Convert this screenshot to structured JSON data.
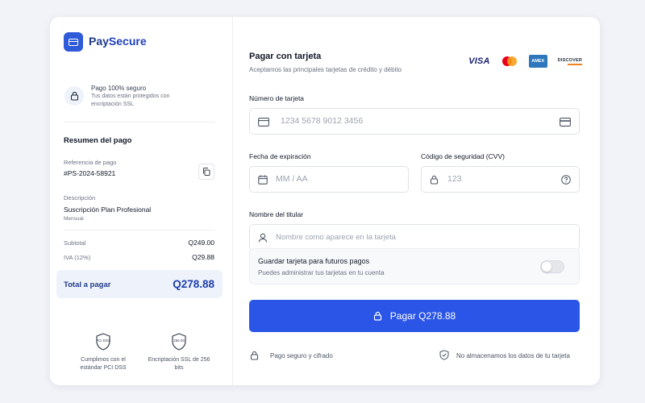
{
  "brand": {
    "name_prefix": "Pay",
    "name_suffix": "Secure"
  },
  "security": {
    "title": "Pago 100% seguro",
    "subtitle": "Tus datos están protegidos con encriptación SSL"
  },
  "summary": {
    "title": "Resumen del pago",
    "reference_label": "Referencia de pago",
    "reference_value": "#PS-2024-58921",
    "description_label": "Descripción",
    "description_value": "Suscripción Plan Profesional",
    "description_period": "Mensual",
    "subtotal_label": "Subtotal",
    "subtotal_value": "Q249.00",
    "tax_label": "IVA (12%)",
    "tax_value": "Q29.88",
    "total_label": "Total a pagar",
    "total_value": "Q278.88"
  },
  "badges": [
    {
      "icon": "shield-pci-icon",
      "icon_text": "PCI DSS",
      "text": "Cumplimos con el estándar PCI DSS"
    },
    {
      "icon": "shield-256-icon",
      "icon_text": "256 bit",
      "text": "Encriptación SSL de 256 bits"
    }
  ],
  "form": {
    "title": "Pagar con tarjeta",
    "subtitle": "Aceptamos las principales tarjetas de crédito y débito",
    "card_logos": {
      "visa": "VISA",
      "amex": "AMEX",
      "discover": "DISCOVER"
    },
    "card_number_label": "Número de tarjeta",
    "card_number_placeholder": "1234 5678 9012 3456",
    "expiry_label": "Fecha de expiración",
    "expiry_placeholder": "MM / AA",
    "cvv_label": "Código de seguridad (CVV)",
    "cvv_placeholder": "123",
    "holder_label": "Nombre del titular",
    "holder_placeholder": "Nombre como aparece en la tarjeta",
    "save_card_title": "Guardar tarjeta para futuros pagos",
    "save_card_sub": "Puedes administrar tus tarjetas en tu cuenta",
    "save_card_enabled": false,
    "pay_button": "Pagar Q278.88",
    "footer_left": "Pago seguro y cifrado",
    "footer_right": "No almacenamos los datos de tu tarjeta"
  },
  "colors": {
    "primary": "#2b55e6",
    "brand_dark": "#1e3a8a",
    "accent_bg": "#eef2fb"
  }
}
